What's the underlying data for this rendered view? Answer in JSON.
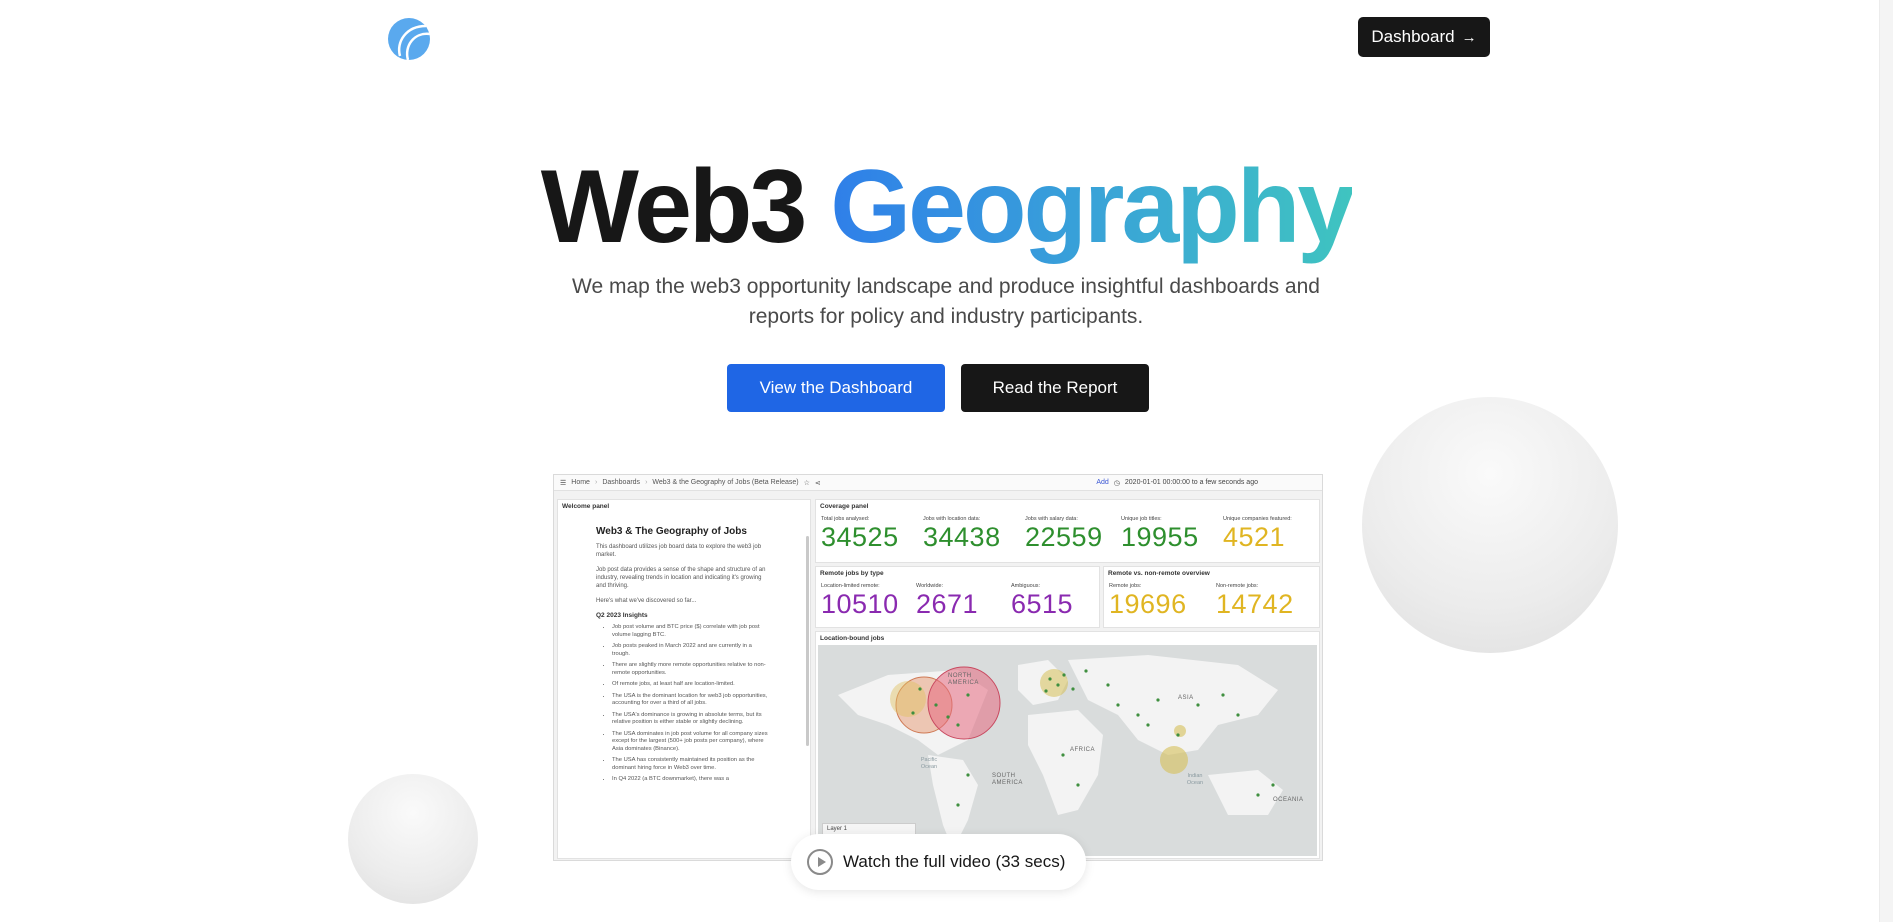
{
  "header": {
    "logo_icon": "planet-logo-icon",
    "dashboard_button": {
      "label": "Dashboard",
      "icon": "arrow-right-icon"
    }
  },
  "hero": {
    "title_plain": "Web3",
    "title_accent": "Geography",
    "subtitle": "We map the web3 opportunity landscape and produce insightful dashboards and reports for policy and industry participants.",
    "primary_cta": "View the Dashboard",
    "secondary_cta": "Read the Report"
  },
  "colors": {
    "primary_blue": "#1f66e5",
    "dark": "#171717",
    "gradient": [
      "#2f7fe9",
      "#3fc4c0"
    ]
  },
  "dashboard_preview": {
    "toolbar": {
      "crumbs": [
        "Home",
        "Dashboards",
        "Web3 & the Geography of Jobs (Beta Release)"
      ],
      "add": "Add",
      "time_range": "2020-01-01 00:00:00 to a few seconds ago"
    },
    "welcome": {
      "label": "Welcome panel",
      "title": "Web3 & The Geography of Jobs",
      "p1": "This dashboard utilizes job board data to explore the web3 job market.",
      "p2": "Job post data provides a sense of the shape and structure of an industry, revealing trends in location and indicating it's growing and thriving.",
      "p3": "Here's what we've discovered so far...",
      "insights_heading": "Q2 2023 Insights",
      "insights": [
        "Job post volume and BTC price ($) correlate with job post volume lagging BTC.",
        "Job posts peaked in March 2022 and are currently in a trough.",
        "There are slightly more remote opportunities relative to non-remote opportunities.",
        "Of remote jobs, at least half are location-limited.",
        "The USA is the dominant location for web3 job opportunities, accounting for over a third of all jobs.",
        "The USA's dominance is growing in absolute terms, but its relative position is either stable or slightly declining.",
        "The USA dominates in job post volume for all company sizes except for the largest (500+ job posts per company), where Asia dominates (Binance).",
        "The USA has consistently maintained its position as the dominant hiring force in Web3 over time.",
        "In Q4 2022 (a BTC downmarket), there was a"
      ]
    },
    "coverage": {
      "label": "Coverage panel",
      "stats": [
        {
          "label": "Total jobs analysed:",
          "value": "34525"
        },
        {
          "label": "Jobs with location data:",
          "value": "34438"
        },
        {
          "label": "Jobs with salary data:",
          "value": "22559"
        },
        {
          "label": "Unique job titles:",
          "value": "19955"
        },
        {
          "label": "Unique companies featured:",
          "value": "4521"
        }
      ]
    },
    "remote": {
      "label": "Remote jobs by type",
      "stats": [
        {
          "label": "Location-limited remote:",
          "value": "10510"
        },
        {
          "label": "Worldwide:",
          "value": "2671"
        },
        {
          "label": "Ambiguous:",
          "value": "6515"
        }
      ]
    },
    "overview": {
      "label": "Remote vs. non-remote overview",
      "stats": [
        {
          "label": "Remote jobs:",
          "value": "19696"
        },
        {
          "label": "Non-remote jobs:",
          "value": "14742"
        }
      ]
    },
    "location": {
      "label": "Location-bound jobs",
      "map_labels": {
        "north_america": "NORTH AMERICA",
        "asia": "ASIA",
        "africa": "AFRICA",
        "south_america": "SOUTH AMERICA",
        "oceania": "OCEANIA",
        "pacific": "Pacific Ocean",
        "indian": "Indian Ocean"
      },
      "layer": "Layer 1"
    }
  },
  "video": {
    "label": "Watch the full video (33 secs)",
    "icon": "play-circle-icon"
  }
}
